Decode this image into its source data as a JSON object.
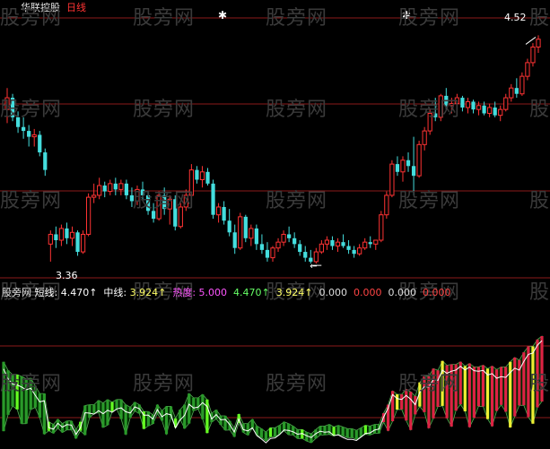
{
  "header": {
    "stock_name": "华联控股",
    "period": "日线"
  },
  "watermark": "股旁网",
  "indicator_bar": {
    "panel_label": "股旁网",
    "items": [
      {
        "label": "短线",
        "value": "4.470↑",
        "color": "#ffffff"
      },
      {
        "label": "中线",
        "value": "3.924↑",
        "color": "#ffff66"
      },
      {
        "label": "热度",
        "value": "5.000",
        "color": "#ff55ff"
      },
      {
        "label": "",
        "value": "4.470↑",
        "color": "#66ff66"
      },
      {
        "label": "",
        "value": "3.924↑",
        "color": "#ffff66"
      },
      {
        "label": "",
        "value": "0.000",
        "color": "#dddddd"
      },
      {
        "label": "",
        "value": "0.000",
        "color": "#ff4444"
      },
      {
        "label": "",
        "value": "0.000",
        "color": "#dddddd"
      },
      {
        "label": "",
        "value": "0.000",
        "color": "#ff4444"
      }
    ]
  },
  "annotations": {
    "high_label": "4.52",
    "low_label": "3.36"
  },
  "colors": {
    "up": "#ff3333",
    "down": "#44dddd",
    "grid": "#8b1a1a",
    "ind_green": "#2a9a2a",
    "ind_green_bright": "#66ff22",
    "ind_red": "#dd2244",
    "ind_yellow": "#eeee33"
  },
  "chart_data": [
    {
      "type": "candlestick",
      "title": "华联控股 日线",
      "yrange_approx": [
        3.2,
        4.6
      ],
      "annotated_high": 4.52,
      "annotated_low": 3.36,
      "candles_ohlc": [
        [
          4.14,
          4.25,
          4.07,
          4.2
        ],
        [
          4.2,
          4.22,
          4.08,
          4.1
        ],
        [
          4.1,
          4.13,
          4.02,
          4.05
        ],
        [
          4.05,
          4.1,
          3.99,
          4.03
        ],
        [
          4.03,
          4.06,
          3.95,
          4.0
        ],
        [
          4.0,
          4.04,
          3.95,
          4.01
        ],
        [
          4.01,
          4.03,
          3.9,
          3.92
        ],
        [
          3.92,
          3.94,
          3.8,
          3.83
        ],
        [
          3.45,
          3.52,
          3.36,
          3.5
        ],
        [
          3.5,
          3.54,
          3.43,
          3.47
        ],
        [
          3.47,
          3.55,
          3.44,
          3.53
        ],
        [
          3.53,
          3.56,
          3.45,
          3.48
        ],
        [
          3.48,
          3.54,
          3.44,
          3.51
        ],
        [
          3.51,
          3.52,
          3.39,
          3.41
        ],
        [
          3.41,
          3.52,
          3.4,
          3.5
        ],
        [
          3.5,
          3.71,
          3.49,
          3.69
        ],
        [
          3.69,
          3.76,
          3.66,
          3.7
        ],
        [
          3.7,
          3.79,
          3.68,
          3.75
        ],
        [
          3.75,
          3.77,
          3.69,
          3.72
        ],
        [
          3.72,
          3.78,
          3.7,
          3.76
        ],
        [
          3.76,
          3.79,
          3.7,
          3.73
        ],
        [
          3.73,
          3.78,
          3.7,
          3.76
        ],
        [
          3.76,
          3.78,
          3.68,
          3.7
        ],
        [
          3.7,
          3.74,
          3.64,
          3.67
        ],
        [
          3.67,
          3.75,
          3.65,
          3.73
        ],
        [
          3.73,
          3.77,
          3.68,
          3.7
        ],
        [
          3.7,
          3.72,
          3.6,
          3.62
        ],
        [
          3.62,
          3.66,
          3.56,
          3.58
        ],
        [
          3.58,
          3.72,
          3.57,
          3.7
        ],
        [
          3.7,
          3.74,
          3.6,
          3.63
        ],
        [
          3.63,
          3.7,
          3.55,
          3.68
        ],
        [
          3.68,
          3.7,
          3.52,
          3.54
        ],
        [
          3.54,
          3.66,
          3.53,
          3.64
        ],
        [
          3.64,
          3.73,
          3.62,
          3.7
        ],
        [
          3.7,
          3.86,
          3.68,
          3.83
        ],
        [
          3.83,
          3.85,
          3.76,
          3.78
        ],
        [
          3.78,
          3.85,
          3.74,
          3.82
        ],
        [
          3.82,
          3.84,
          3.75,
          3.76
        ],
        [
          3.76,
          3.78,
          3.58,
          3.6
        ],
        [
          3.6,
          3.66,
          3.56,
          3.64
        ],
        [
          3.64,
          3.67,
          3.55,
          3.57
        ],
        [
          3.57,
          3.63,
          3.49,
          3.51
        ],
        [
          3.51,
          3.55,
          3.4,
          3.43
        ],
        [
          3.43,
          3.61,
          3.42,
          3.59
        ],
        [
          3.59,
          3.6,
          3.46,
          3.48
        ],
        [
          3.48,
          3.55,
          3.44,
          3.53
        ],
        [
          3.53,
          3.55,
          3.42,
          3.45
        ],
        [
          3.45,
          3.5,
          3.4,
          3.42
        ],
        [
          3.42,
          3.46,
          3.36,
          3.38
        ],
        [
          3.38,
          3.44,
          3.36,
          3.43
        ],
        [
          3.43,
          3.48,
          3.41,
          3.46
        ],
        [
          3.46,
          3.52,
          3.44,
          3.5
        ],
        [
          3.5,
          3.54,
          3.46,
          3.48
        ],
        [
          3.48,
          3.51,
          3.43,
          3.45
        ],
        [
          3.45,
          3.47,
          3.39,
          3.41
        ],
        [
          3.41,
          3.44,
          3.36,
          3.38
        ],
        [
          3.38,
          3.42,
          3.35,
          3.36
        ],
        [
          3.36,
          3.43,
          3.35,
          3.41
        ],
        [
          3.41,
          3.47,
          3.4,
          3.45
        ],
        [
          3.45,
          3.49,
          3.42,
          3.47
        ],
        [
          3.47,
          3.49,
          3.42,
          3.44
        ],
        [
          3.44,
          3.48,
          3.41,
          3.46
        ],
        [
          3.46,
          3.5,
          3.43,
          3.44
        ],
        [
          3.44,
          3.47,
          3.4,
          3.42
        ],
        [
          3.42,
          3.44,
          3.38,
          3.4
        ],
        [
          3.4,
          3.45,
          3.39,
          3.43
        ],
        [
          3.43,
          3.48,
          3.42,
          3.46
        ],
        [
          3.46,
          3.49,
          3.43,
          3.45
        ],
        [
          3.45,
          3.47,
          3.42,
          3.47
        ],
        [
          3.47,
          3.62,
          3.46,
          3.6
        ],
        [
          3.6,
          3.72,
          3.58,
          3.7
        ],
        [
          3.7,
          3.88,
          3.69,
          3.86
        ],
        [
          3.86,
          3.9,
          3.8,
          3.82
        ],
        [
          3.82,
          3.9,
          3.77,
          3.88
        ],
        [
          3.88,
          3.92,
          3.82,
          3.85
        ],
        [
          3.85,
          4.0,
          3.7,
          3.8
        ],
        [
          3.8,
          3.98,
          3.79,
          3.96
        ],
        [
          3.96,
          4.05,
          3.93,
          4.03
        ],
        [
          4.03,
          4.14,
          4.01,
          4.12
        ],
        [
          4.12,
          4.2,
          4.08,
          4.1
        ],
        [
          4.1,
          4.22,
          4.08,
          4.21
        ],
        [
          4.21,
          4.25,
          4.14,
          4.16
        ],
        [
          4.16,
          4.2,
          4.12,
          4.17
        ],
        [
          4.17,
          4.22,
          4.14,
          4.2
        ],
        [
          4.2,
          4.21,
          4.13,
          4.15
        ],
        [
          4.15,
          4.2,
          4.12,
          4.18
        ],
        [
          4.18,
          4.19,
          4.12,
          4.14
        ],
        [
          4.14,
          4.18,
          4.11,
          4.16
        ],
        [
          4.16,
          4.18,
          4.11,
          4.12
        ],
        [
          4.12,
          4.17,
          4.1,
          4.15
        ],
        [
          4.15,
          4.18,
          4.1,
          4.11
        ],
        [
          4.11,
          4.16,
          4.08,
          4.14
        ],
        [
          4.14,
          4.22,
          4.13,
          4.2
        ],
        [
          4.2,
          4.27,
          4.18,
          4.25
        ],
        [
          4.25,
          4.3,
          4.2,
          4.22
        ],
        [
          4.22,
          4.33,
          4.21,
          4.31
        ],
        [
          4.31,
          4.4,
          4.29,
          4.38
        ],
        [
          4.38,
          4.48,
          4.36,
          4.46
        ],
        [
          4.46,
          4.52,
          4.43,
          4.5
        ]
      ]
    },
    {
      "type": "bar",
      "title": "短线 / 中线 / 热度",
      "note": "histogram bars reconstructed visually; green in downtrend, red/yellow in uptrend"
    }
  ]
}
